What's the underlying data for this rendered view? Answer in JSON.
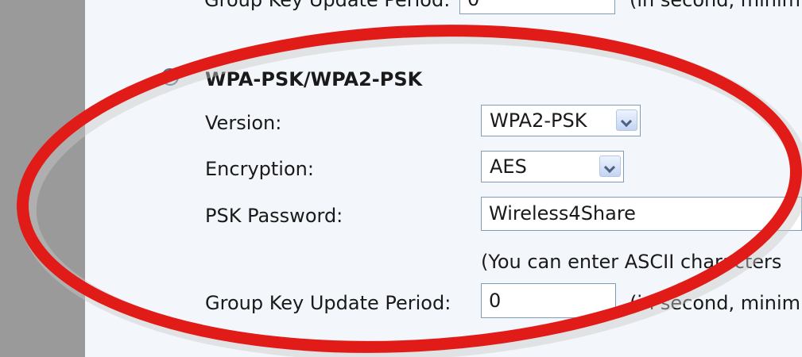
{
  "top_partial": {
    "label": "Group Key Update Period:",
    "value": "0",
    "hint": "(in second, minim"
  },
  "wpa_psk": {
    "title": "WPA-PSK/WPA2-PSK",
    "selected": true,
    "version": {
      "label": "Version:",
      "value": "WPA2-PSK"
    },
    "encryption": {
      "label": "Encryption:",
      "value": "AES"
    },
    "psk_password": {
      "label": "PSK Password:",
      "value": "Wireless4Share",
      "hint": "(You can enter ASCII characters"
    },
    "group_key": {
      "label": "Group Key Update Period:",
      "value": "0",
      "hint": "(in second, minim"
    }
  },
  "colors": {
    "annotation_ellipse": "#e11b17",
    "left_bar": "#9a9a9a",
    "panel_bg": "#f3f6fa",
    "radio_dot": "#2aa12a"
  }
}
